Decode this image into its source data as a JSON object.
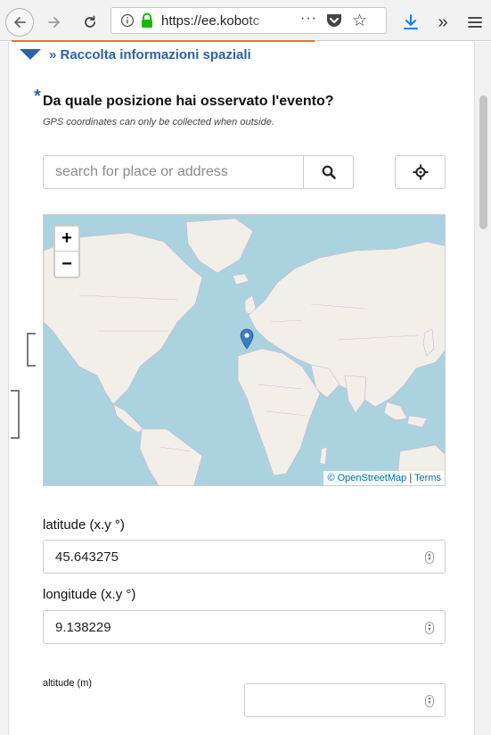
{
  "browser": {
    "url": "https://ee.kobotc",
    "more_label": "···",
    "overflow_label": "»"
  },
  "form": {
    "section_title": "» Raccolta informazioni spaziali",
    "required_mark": "*",
    "question": "Da quale posizione hai osservato l'evento?",
    "hint": "GPS coordinates can only be collected when outside.",
    "search": {
      "placeholder": "search for place or address"
    },
    "map": {
      "zoom_in_label": "+",
      "zoom_out_label": "−",
      "attribution": "© OpenStreetMap",
      "attribution_sep": " | ",
      "terms_label": "Terms"
    },
    "latitude": {
      "label": "latitude (x.y °)",
      "value": "45.643275"
    },
    "longitude": {
      "label": "longitude (x.y °)",
      "value": "9.138229"
    },
    "altitude": {
      "label": "altitude (m)",
      "value": ""
    }
  },
  "colors": {
    "accent_orange": "#e0781e",
    "link_blue": "#2b63a6",
    "map_water": "#aad3df",
    "map_land": "#f2efe9",
    "marker": "#3b7cc5"
  },
  "icons": [
    "back-arrow-icon",
    "forward-arrow-icon",
    "reload-icon",
    "info-icon",
    "lock-icon",
    "pocket-icon",
    "star-icon",
    "download-icon",
    "hamburger-menu-icon",
    "search-icon",
    "crosshair-icon",
    "map-marker-icon"
  ]
}
